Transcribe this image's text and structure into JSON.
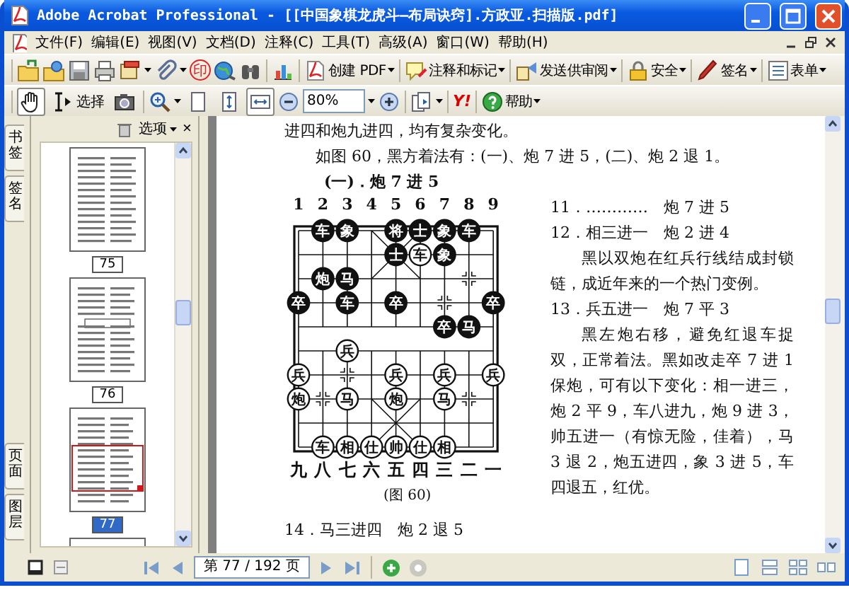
{
  "window": {
    "title": "Adobe Acrobat Professional - [[中国象棋龙虎斗—布局诀窍].方政亚.扫描版.pdf]"
  },
  "menu": [
    "文件(F)",
    "编辑(E)",
    "视图(V)",
    "文档(D)",
    "注释(C)",
    "工具(T)",
    "高级(A)",
    "窗口(W)",
    "帮助(H)"
  ],
  "toolbar1": {
    "stamp": "印",
    "buttons": [
      "创建 PDF",
      "注释和标记",
      "发送供审阅",
      "安全",
      "签名",
      "表单"
    ]
  },
  "toolbar2": {
    "tools": [
      {
        "selected": true
      },
      {
        "label": "选择",
        "selected": false
      },
      {
        "selected": false
      }
    ],
    "view_buttons": [
      {
        "selected": false
      },
      {
        "selected": false
      },
      {
        "selected": true
      }
    ],
    "zoom": "80%",
    "yahoo": "Y!",
    "help": "帮助"
  },
  "side_tabs": [
    "书签",
    "签名",
    "页面",
    "图层"
  ],
  "panel": {
    "options": "选项",
    "close": "×",
    "thumbnails": [
      {
        "label": "75",
        "selected": false
      },
      {
        "label": "76",
        "selected": false
      },
      {
        "label": "77",
        "selected": true
      }
    ]
  },
  "document": {
    "intro": [
      "进四和炮九进四，均有复杂变化。",
      "如图 60，黑方着法有：(一)、炮 7 进 5，(二)、炮 2 退 1。",
      "(一)．炮 7 进 5"
    ],
    "board": {
      "top_labels": [
        "1",
        "2",
        "3",
        "4",
        "5",
        "6",
        "7",
        "8",
        "9"
      ],
      "bottom_labels": [
        "九",
        "八",
        "七",
        "六",
        "五",
        "四",
        "三",
        "二",
        "一"
      ],
      "rows": [
        [
          null,
          {
            "char": "车",
            "color": "#111111"
          },
          {
            "char": "象",
            "color": "#111111"
          },
          null,
          {
            "char": "将",
            "color": "#111111"
          },
          {
            "char": "士",
            "color": "#111111"
          },
          {
            "char": "象",
            "color": "#111111"
          },
          {
            "char": "车",
            "color": "#111111"
          },
          null
        ],
        [
          null,
          null,
          null,
          null,
          {
            "char": "士",
            "color": "#111111"
          },
          {
            "char": "车",
            "color": "#ffffff"
          },
          {
            "char": "象",
            "color": "#111111"
          },
          null,
          null
        ],
        [
          null,
          {
            "char": "炮",
            "color": "#111111"
          },
          {
            "char": "马",
            "color": "#111111"
          },
          null,
          null,
          null,
          null,
          null,
          null
        ],
        [
          {
            "char": "卒",
            "color": "#111111"
          },
          null,
          {
            "char": "车",
            "color": "#111111"
          },
          null,
          {
            "char": "卒",
            "color": "#111111"
          },
          null,
          null,
          null,
          {
            "char": "卒",
            "color": "#111111"
          }
        ],
        [
          null,
          null,
          null,
          null,
          null,
          null,
          {
            "char": "卒",
            "color": "#111111"
          },
          {
            "char": "马",
            "color": "#111111"
          },
          null
        ],
        [
          null,
          null,
          {
            "char": "兵",
            "color": "#ffffff"
          },
          null,
          null,
          null,
          null,
          null,
          null
        ],
        [
          {
            "char": "兵",
            "color": "#ffffff"
          },
          null,
          null,
          null,
          {
            "char": "兵",
            "color": "#ffffff"
          },
          null,
          {
            "char": "兵",
            "color": "#ffffff"
          },
          null,
          {
            "char": "兵",
            "color": "#ffffff"
          }
        ],
        [
          {
            "char": "炮",
            "color": "#ffffff"
          },
          null,
          {
            "char": "马",
            "color": "#ffffff"
          },
          null,
          {
            "char": "炮",
            "color": "#ffffff"
          },
          null,
          {
            "char": "马",
            "color": "#ffffff"
          },
          null,
          null
        ],
        [
          null,
          null,
          null,
          null,
          null,
          null,
          null,
          null,
          null
        ],
        [
          null,
          {
            "char": "车",
            "color": "#ffffff"
          },
          {
            "char": "相",
            "color": "#ffffff"
          },
          {
            "char": "仕",
            "color": "#ffffff"
          },
          {
            "char": "帅",
            "color": "#ffffff"
          },
          {
            "char": "仕",
            "color": "#ffffff"
          },
          {
            "char": "相",
            "color": "#ffffff"
          },
          null,
          null
        ]
      ],
      "caption": "(图 60)"
    },
    "moves": [
      {
        "kind": "move",
        "text": "11．…………　炮 7 进 5"
      },
      {
        "kind": "move",
        "text": "12．相三进一　炮 2 进 4"
      },
      {
        "kind": "comment",
        "text": "黑以双炮在红兵行线结成封锁链，成近年来的一个热门变例。"
      },
      {
        "kind": "move",
        "text": "13．兵五进一　炮 7 平 3"
      },
      {
        "kind": "comment",
        "text": "黑左炮右移，避免红退车捉双，正常着法。黑如改走卒 7 进 1 保炮，可有以下变化：相一进三，炮 2 平 9，车八进九，炮 9 进 3，帅五进一（有惊无险，佳着），马 3 退 2，炮五进四，象 3 进 5，车四退五，红优。"
      }
    ],
    "after": "14．马三进四　炮 2 退 5"
  },
  "navigation": {
    "page_field": "第 77 / 192 页"
  }
}
